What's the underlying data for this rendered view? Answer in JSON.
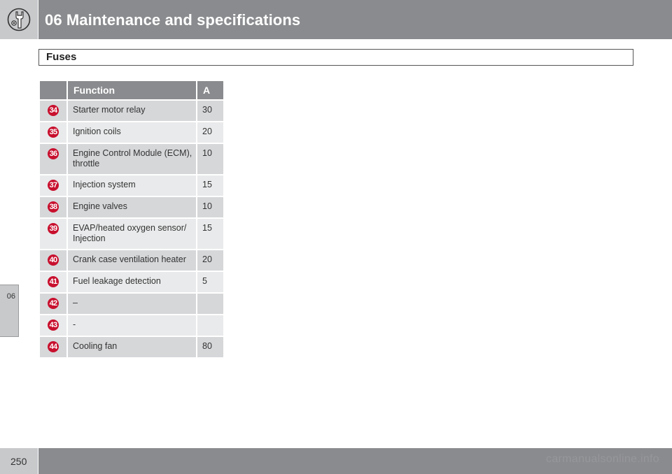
{
  "header": {
    "title": "06 Maintenance and specifications",
    "icon": "wrench-icon"
  },
  "section": {
    "title": "Fuses"
  },
  "table": {
    "columns": [
      "",
      "Function",
      "A"
    ],
    "rows": [
      {
        "num": "34",
        "function": "Starter motor relay",
        "amps": "30"
      },
      {
        "num": "35",
        "function": "Ignition coils",
        "amps": "20"
      },
      {
        "num": "36",
        "function": "Engine Control Module (ECM), throttle",
        "amps": "10"
      },
      {
        "num": "37",
        "function": "Injection system",
        "amps": "15"
      },
      {
        "num": "38",
        "function": "Engine valves",
        "amps": "10"
      },
      {
        "num": "39",
        "function": "EVAP/heated oxygen sensor/ Injection",
        "amps": "15"
      },
      {
        "num": "40",
        "function": "Crank case ventilation heater",
        "amps": "20"
      },
      {
        "num": "41",
        "function": "Fuel leakage detection",
        "amps": "5"
      },
      {
        "num": "42",
        "function": "–",
        "amps": ""
      },
      {
        "num": "43",
        "function": "-",
        "amps": ""
      },
      {
        "num": "44",
        "function": "Cooling fan",
        "amps": "80"
      }
    ]
  },
  "side_tab": {
    "label": "06"
  },
  "footer": {
    "page_number": "250",
    "watermark": "carmanualsonline.info"
  },
  "colors": {
    "band": "#8a8b8e",
    "band_light": "#c8c9cb",
    "badge": "#c8102e"
  }
}
